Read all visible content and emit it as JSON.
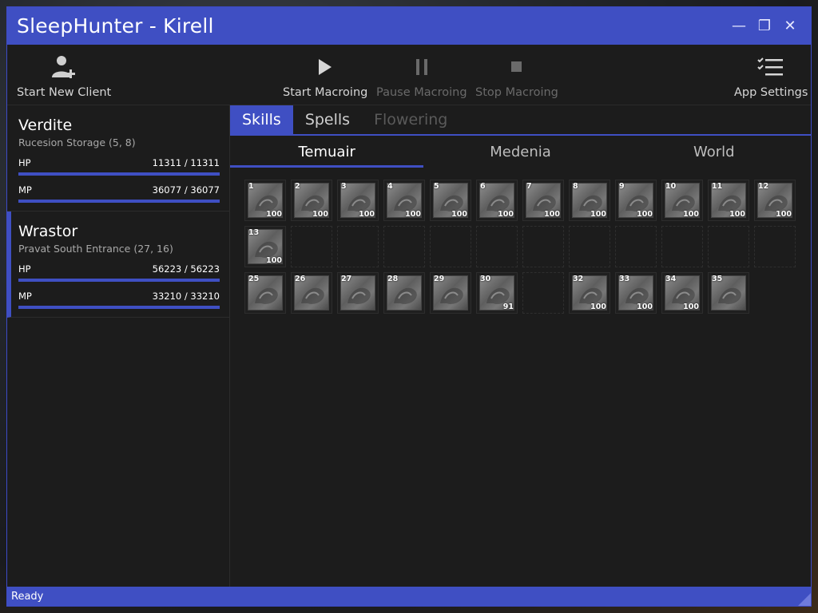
{
  "window": {
    "title": "SleepHunter - Kirell"
  },
  "toolbar": {
    "start_new_client": "Start New Client",
    "start_macroing": "Start Macroing",
    "pause_macroing": "Pause Macroing",
    "stop_macroing": "Stop Macroing",
    "app_settings": "App Settings"
  },
  "clients": [
    {
      "name": "Verdite",
      "location": "Rucesion Storage (5, 8)",
      "hp_label": "HP",
      "hp": "11311 / 11311",
      "hp_fraction": 1.0,
      "mp_label": "MP",
      "mp": "36077 / 36077",
      "mp_fraction": 1.0
    },
    {
      "name": "Wrastor",
      "location": "Pravat South Entrance (27, 16)",
      "hp_label": "HP",
      "hp": "56223 / 56223",
      "hp_fraction": 1.0,
      "mp_label": "MP",
      "mp": "33210 / 33210",
      "mp_fraction": 1.0
    }
  ],
  "tabs": [
    "Skills",
    "Spells",
    "Flowering"
  ],
  "subtabs": [
    "Temuair",
    "Medenia",
    "World"
  ],
  "skills": [
    {
      "num": "1",
      "level": "100"
    },
    {
      "num": "2",
      "level": "100"
    },
    {
      "num": "3",
      "level": "100"
    },
    {
      "num": "4",
      "level": "100"
    },
    {
      "num": "5",
      "level": "100"
    },
    {
      "num": "6",
      "level": "100"
    },
    {
      "num": "7",
      "level": "100"
    },
    {
      "num": "8",
      "level": "100"
    },
    {
      "num": "9",
      "level": "100"
    },
    {
      "num": "10",
      "level": "100"
    },
    {
      "num": "11",
      "level": "100"
    },
    {
      "num": "12",
      "level": "100"
    },
    {
      "num": "13",
      "level": "100"
    },
    {
      "num": "25",
      "level": ""
    },
    {
      "num": "26",
      "level": ""
    },
    {
      "num": "27",
      "level": ""
    },
    {
      "num": "28",
      "level": ""
    },
    {
      "num": "29",
      "level": ""
    },
    {
      "num": "30",
      "level": "91"
    },
    {
      "num": "32",
      "level": "100"
    },
    {
      "num": "33",
      "level": "100"
    },
    {
      "num": "34",
      "level": "100"
    },
    {
      "num": "35",
      "level": ""
    }
  ],
  "status": {
    "text": "Ready"
  },
  "colors": {
    "accent": "#3f4fc3",
    "background": "#1c1c1c"
  }
}
